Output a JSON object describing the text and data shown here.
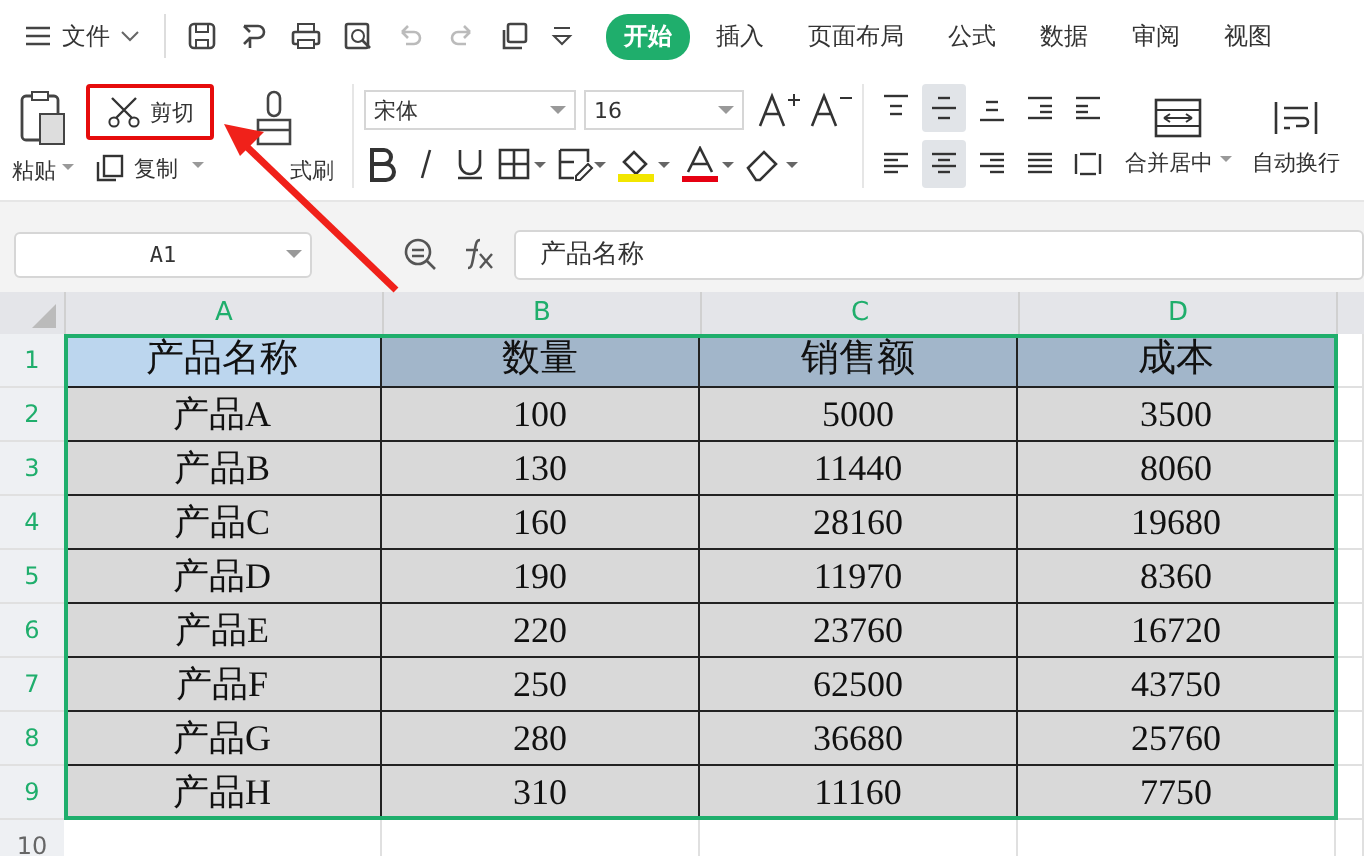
{
  "menu": {
    "file": "文件"
  },
  "tabs": [
    {
      "label": "开始",
      "selected": true
    },
    {
      "label": "插入",
      "selected": false
    },
    {
      "label": "页面布局",
      "selected": false
    },
    {
      "label": "公式",
      "selected": false
    },
    {
      "label": "数据",
      "selected": false
    },
    {
      "label": "审阅",
      "selected": false
    },
    {
      "label": "视图",
      "selected": false
    }
  ],
  "clipboard": {
    "paste": "粘贴",
    "cut": "剪切",
    "cut_highlighted": true,
    "copy": "复制",
    "format_painter": "式刷"
  },
  "font": {
    "name": "宋体",
    "size": "16"
  },
  "alignment": [
    {
      "kind": "top",
      "selected": false
    },
    {
      "kind": "middle",
      "selected": true
    },
    {
      "kind": "bottom",
      "selected": false
    },
    {
      "kind": "outdent",
      "selected": false
    },
    {
      "kind": "indent",
      "selected": false
    },
    {
      "kind": "left",
      "selected": false
    },
    {
      "kind": "center",
      "selected": true
    },
    {
      "kind": "right",
      "selected": false
    },
    {
      "kind": "justify",
      "selected": false
    },
    {
      "kind": "distributed",
      "selected": false
    }
  ],
  "merge": "合并居中",
  "wrap": "自动换行",
  "name_box": "A1",
  "formula": "产品名称",
  "columns": [
    {
      "label": "A",
      "selected": true,
      "active": true
    },
    {
      "label": "B",
      "selected": true,
      "active": false
    },
    {
      "label": "C",
      "selected": true,
      "active": false
    },
    {
      "label": "D",
      "selected": true,
      "active": false
    }
  ],
  "rows": [
    {
      "number": "1",
      "selected": true,
      "active": true,
      "kind": "header",
      "cells": [
        "产品名称",
        "数量",
        "销售额",
        "成本"
      ]
    },
    {
      "number": "2",
      "selected": true,
      "active": false,
      "kind": "data",
      "cells": [
        "产品A",
        "100",
        "5000",
        "3500"
      ]
    },
    {
      "number": "3",
      "selected": true,
      "active": false,
      "kind": "data",
      "cells": [
        "产品B",
        "130",
        "11440",
        "8060"
      ]
    },
    {
      "number": "4",
      "selected": true,
      "active": false,
      "kind": "data",
      "cells": [
        "产品C",
        "160",
        "28160",
        "19680"
      ]
    },
    {
      "number": "5",
      "selected": true,
      "active": false,
      "kind": "data",
      "cells": [
        "产品D",
        "190",
        "11970",
        "8360"
      ]
    },
    {
      "number": "6",
      "selected": true,
      "active": false,
      "kind": "data",
      "cells": [
        "产品E",
        "220",
        "23760",
        "16720"
      ]
    },
    {
      "number": "7",
      "selected": true,
      "active": false,
      "kind": "data",
      "cells": [
        "产品F",
        "250",
        "62500",
        "43750"
      ]
    },
    {
      "number": "8",
      "selected": true,
      "active": false,
      "kind": "data",
      "cells": [
        "产品G",
        "280",
        "36680",
        "25760"
      ]
    },
    {
      "number": "9",
      "selected": true,
      "active": false,
      "kind": "data",
      "cells": [
        "产品H",
        "310",
        "11160",
        "7750"
      ]
    },
    {
      "number": "10",
      "selected": false,
      "kind": "empty",
      "cells": []
    }
  ]
}
